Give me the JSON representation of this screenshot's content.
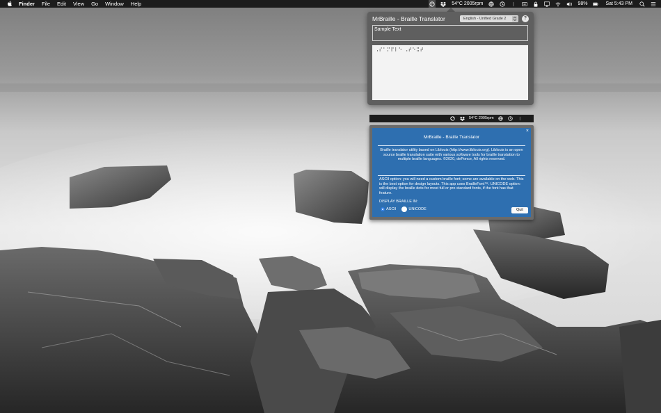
{
  "menubar": {
    "app_name": "Finder",
    "menus": [
      "File",
      "Edit",
      "View",
      "Go",
      "Window",
      "Help"
    ],
    "cpu_stats": "54°C 2005rpm",
    "battery_percent": "98%",
    "clock": "Sat 5:43 PM"
  },
  "translator": {
    "title": "MrBraille - Braille Translator",
    "language_selected": "English - Unified Grade 2",
    "help_label": "?",
    "input_value": "Sample Text",
    "braille_output": "⠠⠎⠁⠍⠏⠇⠑ ⠠⠞⠑⠭⠞"
  },
  "strip": {
    "cpu_stats": "54°C 2005rpm"
  },
  "about": {
    "close_label": "×",
    "title": "MrBraille - Braille Translator",
    "description": "Braille translator utility based on Liblouis (http://www.liblouis.org). Liblouis is an open source braille translation suite with various software tools for braille translation to multiple braille languages. ©2020, dePonce, All rights reserved.",
    "options_text": "ASCII option: you will need a custom braille font; some are available on the web. This is the best option for design layouts. This app uses BrailleFont™. UNICODE option: will display the braille dots for most full or pro standard fonts, if the font has that feature.",
    "display_label": "DISPLAY BRAILLE IN:",
    "radio_ascii": "ASCII",
    "radio_unicode": "UNICODE",
    "selected_mode": "ASCII",
    "quit_label": "Quit"
  },
  "colors": {
    "panel_bg": "#5f5f5f",
    "about_blue": "#2e6fb0",
    "menubar_bg": "#1c1c1c"
  }
}
